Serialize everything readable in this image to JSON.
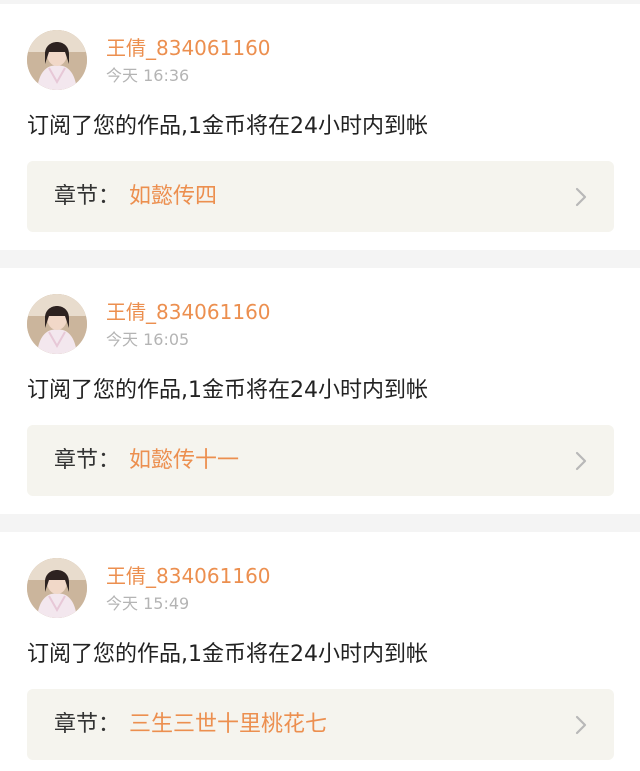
{
  "colors": {
    "accent": "#ec8f4f",
    "timestamp": "#b4b4b4",
    "text": "#222222",
    "chapter_background": "#f5f4ee",
    "page_background": "#f4f4f4"
  },
  "notifications": [
    {
      "user_name": "王倩_834061160",
      "time": "今天 16:36",
      "message": "订阅了您的作品,1金币将在24小时内到帐",
      "chapter_prefix": "章节：",
      "chapter_title": "如懿传四",
      "avatar_icon": "user-avatar",
      "chevron_icon": "chevron-right-icon"
    },
    {
      "user_name": "王倩_834061160",
      "time": "今天 16:05",
      "message": "订阅了您的作品,1金币将在24小时内到帐",
      "chapter_prefix": "章节：",
      "chapter_title": "如懿传十一",
      "avatar_icon": "user-avatar",
      "chevron_icon": "chevron-right-icon"
    },
    {
      "user_name": "王倩_834061160",
      "time": "今天 15:49",
      "message": "订阅了您的作品,1金币将在24小时内到帐",
      "chapter_prefix": "章节：",
      "chapter_title": "三生三世十里桃花七",
      "avatar_icon": "user-avatar",
      "chevron_icon": "chevron-right-icon"
    }
  ]
}
